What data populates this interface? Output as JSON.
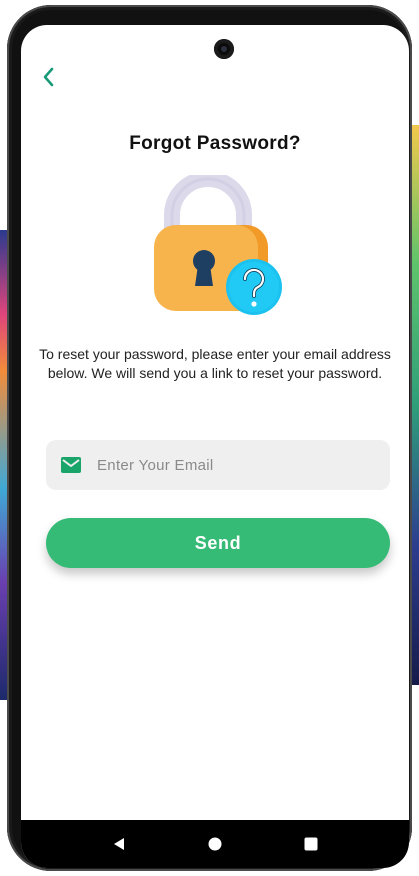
{
  "screen": {
    "title": "Forgot Password?",
    "description": "To reset your password, please enter your email address below. We will send you a link to reset your password.",
    "email": {
      "placeholder": "Enter Your Email",
      "value": "",
      "icon": "mail-icon"
    },
    "send_label": "Send",
    "back_icon": "chevron-left-icon",
    "illustration": "padlock-question-icon"
  },
  "nav": {
    "back": "nav-back-icon",
    "home": "nav-home-icon",
    "recents": "nav-recents-icon"
  },
  "colors": {
    "accent": "#35bb75",
    "mail_icon": "#19a56a",
    "back_chevron": "#1a9a78",
    "lock_body": "#f8b44c",
    "lock_shackle": "#dcd9ea",
    "question_badge": "#1bc2f0"
  }
}
